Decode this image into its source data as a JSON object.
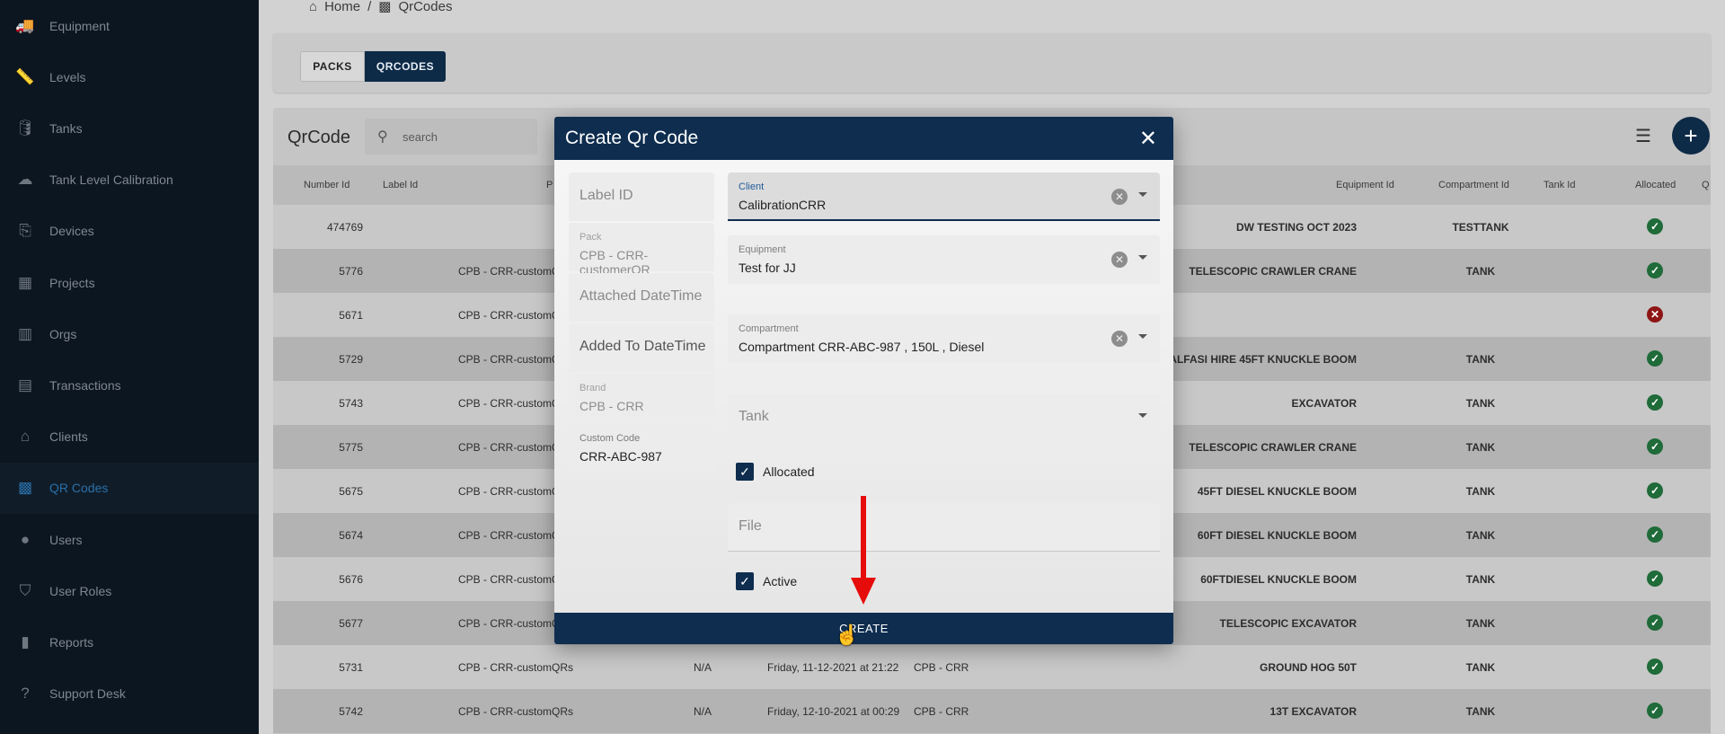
{
  "sidebar": {
    "items": [
      {
        "label": "Equipment",
        "icon": "truck-icon",
        "glyph": "🚚"
      },
      {
        "label": "Levels",
        "icon": "ruler-icon",
        "glyph": "📏"
      },
      {
        "label": "Tanks",
        "icon": "tank-icon",
        "glyph": "🛢"
      },
      {
        "label": "Tank Level Calibration",
        "icon": "gauge-icon",
        "glyph": "☁"
      },
      {
        "label": "Devices",
        "icon": "device-icon",
        "glyph": "⎘"
      },
      {
        "label": "Projects",
        "icon": "map-icon",
        "glyph": "▦"
      },
      {
        "label": "Orgs",
        "icon": "building-icon",
        "glyph": "▥"
      },
      {
        "label": "Transactions",
        "icon": "document-icon",
        "glyph": "▤"
      },
      {
        "label": "Clients",
        "icon": "bank-icon",
        "glyph": "⌂"
      },
      {
        "label": "QR Codes",
        "icon": "qr-code-icon",
        "glyph": "▩"
      },
      {
        "label": "Users",
        "icon": "user-icon",
        "glyph": "●"
      },
      {
        "label": "User Roles",
        "icon": "shield-icon",
        "glyph": "⛉"
      },
      {
        "label": "Reports",
        "icon": "chart-icon",
        "glyph": "▮"
      },
      {
        "label": "Support Desk",
        "icon": "help-icon",
        "glyph": "?"
      }
    ],
    "active": "QR Codes"
  },
  "breadcrumb": {
    "home": "Home",
    "separator": "/",
    "current": "QrCodes"
  },
  "tabs": {
    "packs": "PACKS",
    "qrcodes": "QRCODES"
  },
  "table": {
    "title": "QrCode",
    "search_placeholder": "search",
    "columns": [
      "Number Id",
      "Label Id",
      "P",
      "Equipment Id",
      "Compartment Id",
      "Tank Id",
      "Allocated",
      "Q"
    ],
    "rows": [
      {
        "number": "474769",
        "pack": "",
        "na": "",
        "date": "",
        "brand": "",
        "equipment": "DW TESTING OCT 2023",
        "compartment": "TESTTANK",
        "allocated": true
      },
      {
        "number": "5776",
        "pack": "CPB - CRR-customQ",
        "na": "",
        "date": "",
        "brand": "",
        "equipment": "TELESCOPIC CRAWLER CRANE",
        "compartment": "TANK",
        "allocated": true
      },
      {
        "number": "5671",
        "pack": "CPB - CRR-customQ",
        "na": "",
        "date": "",
        "brand": "",
        "equipment": "",
        "compartment": "",
        "allocated": false
      },
      {
        "number": "5729",
        "pack": "CPB - CRR-customQ",
        "na": "",
        "date": "",
        "brand": "",
        "equipment": "ALFASI HIRE 45FT KNUCKLE BOOM",
        "compartment": "TANK",
        "allocated": true
      },
      {
        "number": "5743",
        "pack": "CPB - CRR-customQ",
        "na": "",
        "date": "",
        "brand": "",
        "equipment": "EXCAVATOR",
        "compartment": "TANK",
        "allocated": true
      },
      {
        "number": "5775",
        "pack": "CPB - CRR-customQ",
        "na": "",
        "date": "",
        "brand": "",
        "equipment": "TELESCOPIC CRAWLER CRANE",
        "compartment": "TANK",
        "allocated": true
      },
      {
        "number": "5675",
        "pack": "CPB - CRR-customQ",
        "na": "",
        "date": "",
        "brand": "",
        "equipment": "45FT DIESEL KNUCKLE BOOM",
        "compartment": "TANK",
        "allocated": true
      },
      {
        "number": "5674",
        "pack": "CPB - CRR-customQ",
        "na": "",
        "date": "",
        "brand": "",
        "equipment": "60FT DIESEL KNUCKLE BOOM",
        "compartment": "TANK",
        "allocated": true
      },
      {
        "number": "5676",
        "pack": "CPB - CRR-customQ",
        "na": "",
        "date": "",
        "brand": "",
        "equipment": "60FTDIESEL KNUCKLE BOOM",
        "compartment": "TANK",
        "allocated": true
      },
      {
        "number": "5677",
        "pack": "CPB - CRR-customQ",
        "na": "",
        "date": "",
        "brand": "",
        "equipment": "TELESCOPIC EXCAVATOR",
        "compartment": "TANK",
        "allocated": true
      },
      {
        "number": "5731",
        "pack": "CPB - CRR-customQRs",
        "na": "N/A",
        "date": "Friday, 11-12-2021 at 21:22",
        "brand": "CPB - CRR",
        "equipment": "GROUND HOG 50T",
        "compartment": "TANK",
        "allocated": true
      },
      {
        "number": "5742",
        "pack": "CPB - CRR-customQRs",
        "na": "N/A",
        "date": "Friday, 12-10-2021 at 00:29",
        "brand": "CPB - CRR",
        "equipment": "13T EXCAVATOR",
        "compartment": "TANK",
        "allocated": true
      }
    ]
  },
  "dialog": {
    "title": "Create Qr Code",
    "left_fields": {
      "label_id": "Label ID",
      "pack_label": "Pack",
      "pack_value": "CPB - CRR-customerQR",
      "attached": "Attached DateTime",
      "added": "Added To DateTime",
      "brand_label": "Brand",
      "brand_value": "CPB - CRR",
      "custom_label": "Custom Code",
      "custom_value": "CRR-ABC-987"
    },
    "right_fields": {
      "client_label": "Client",
      "client_value": "CalibrationCRR",
      "equipment_label": "Equipment",
      "equipment_value": "Test for JJ",
      "compartment_label": "Compartment",
      "compartment_value": "Compartment CRR-ABC-987 , 150L , Diesel",
      "tank_placeholder": "Tank",
      "allocated_label": "Allocated",
      "file_placeholder": "File",
      "active_label": "Active"
    },
    "create_label": "CREATE"
  },
  "colors": {
    "primary": "#0e2d4f",
    "sidebar": "#0c1620",
    "success": "#1f6b39",
    "error": "#8e1515",
    "annotation": "#e60c0c"
  }
}
